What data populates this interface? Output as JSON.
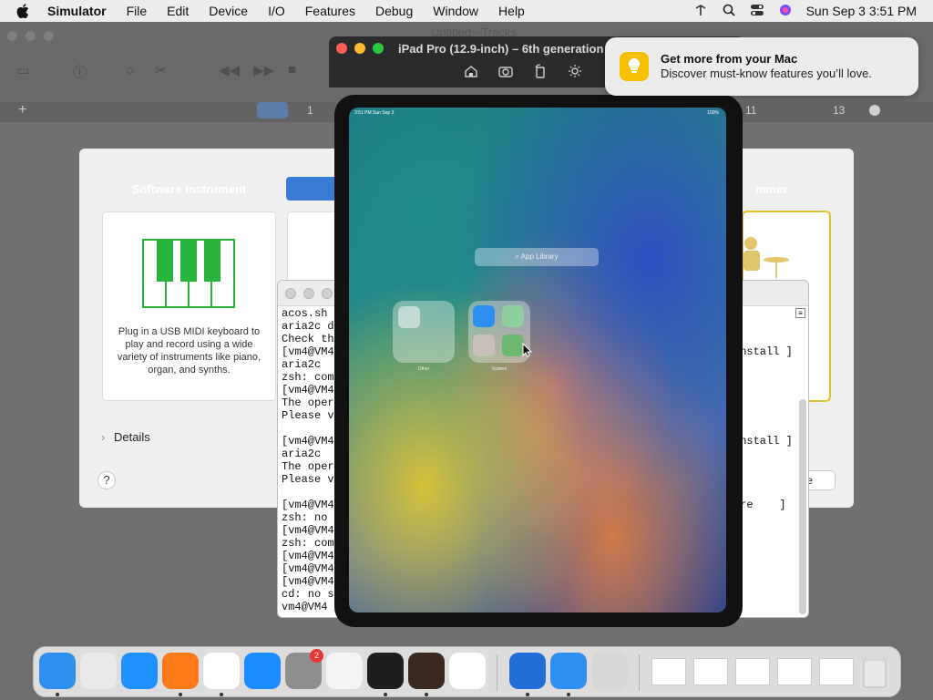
{
  "menubar": {
    "items": [
      "Simulator",
      "File",
      "Edit",
      "Device",
      "I/O",
      "Features",
      "Debug",
      "Window",
      "Help"
    ],
    "datetime": "Sun Sep 3  3:51 PM"
  },
  "garageband": {
    "window_title": "Untitled - Tracks",
    "ruler_numbers": [
      "1",
      "11",
      "13"
    ],
    "dialog": {
      "categories": [
        {
          "label": "Software Instrument",
          "color": "#28b33c"
        },
        {
          "label": "",
          "color": "#3a7bd5"
        },
        {
          "label": "mmer",
          "color": "#c9a400"
        }
      ],
      "card_description": "Plug in a USB MIDI keyboard to play and record using a wide variety of instruments like piano, organ, and synths.",
      "details_label": "Details",
      "help_label": "?",
      "choose_label": "te"
    }
  },
  "terminal": {
    "lines": [
      "acos.sh",
      "aria2c d",
      "Check th",
      "[vm4@VM4",
      "aria2c",
      "zsh: com",
      "[vm4@VM4",
      "The oper",
      "Please v",
      "",
      "[vm4@VM4",
      "aria2c",
      "The oper",
      "Please v",
      "",
      "[vm4@VM4",
      "zsh: no",
      "[vm4@VM4",
      "zsh: com",
      "[vm4@VM4",
      "[vm4@VM4",
      "[vm4@VM4",
      "cd: no s",
      "vm4@VM4"
    ],
    "right_lines": [
      "",
      "",
      "",
      "install ]",
      "",
      "",
      "]",
      "",
      "",
      "",
      "install ]",
      "",
      "",
      "",
      "",
      "ure    ]",
      "",
      "]",
      "",
      "]",
      "]",
      "]",
      "",
      ""
    ]
  },
  "simulator": {
    "title": "iPad Pro (12.9-inch) – 6th generation",
    "toolbar_icons": [
      "home-icon",
      "screenshot-icon",
      "rotate-icon",
      "appearance-icon"
    ],
    "ipad": {
      "status_time": "3:51 PM  Sun Sep 3",
      "status_right": "100%",
      "search_placeholder": "App Library",
      "folders": [
        {
          "label": "Other"
        },
        {
          "label": "System"
        }
      ]
    }
  },
  "notification": {
    "title": "Get more from your Mac",
    "body": "Discover must-know features you’ll love."
  },
  "dock": {
    "settings_badge": "2",
    "apps": [
      {
        "name": "finder-icon",
        "color": "#2f8ff0"
      },
      {
        "name": "launchpad-icon",
        "color": "#e9e9e9"
      },
      {
        "name": "safari-icon",
        "color": "#1e90ff"
      },
      {
        "name": "firefox-icon",
        "color": "#ff7a1a"
      },
      {
        "name": "chrome-icon",
        "color": "#ffffff"
      },
      {
        "name": "app-store-icon",
        "color": "#1a8cff"
      },
      {
        "name": "system-settings-icon",
        "color": "#8e8e8e"
      },
      {
        "name": "textedit-icon",
        "color": "#f4f4f4"
      },
      {
        "name": "terminal-icon",
        "color": "#1e1e1e"
      },
      {
        "name": "garageband-icon",
        "color": "#3a2a20"
      },
      {
        "name": "vscode-icon",
        "color": "#ffffff"
      },
      {
        "name": "xcode-icon",
        "color": "#1f6fd6"
      },
      {
        "name": "simulator-icon",
        "color": "#2f8ff0"
      },
      {
        "name": "quicktime-icon",
        "color": "#d8d8d8"
      }
    ]
  }
}
